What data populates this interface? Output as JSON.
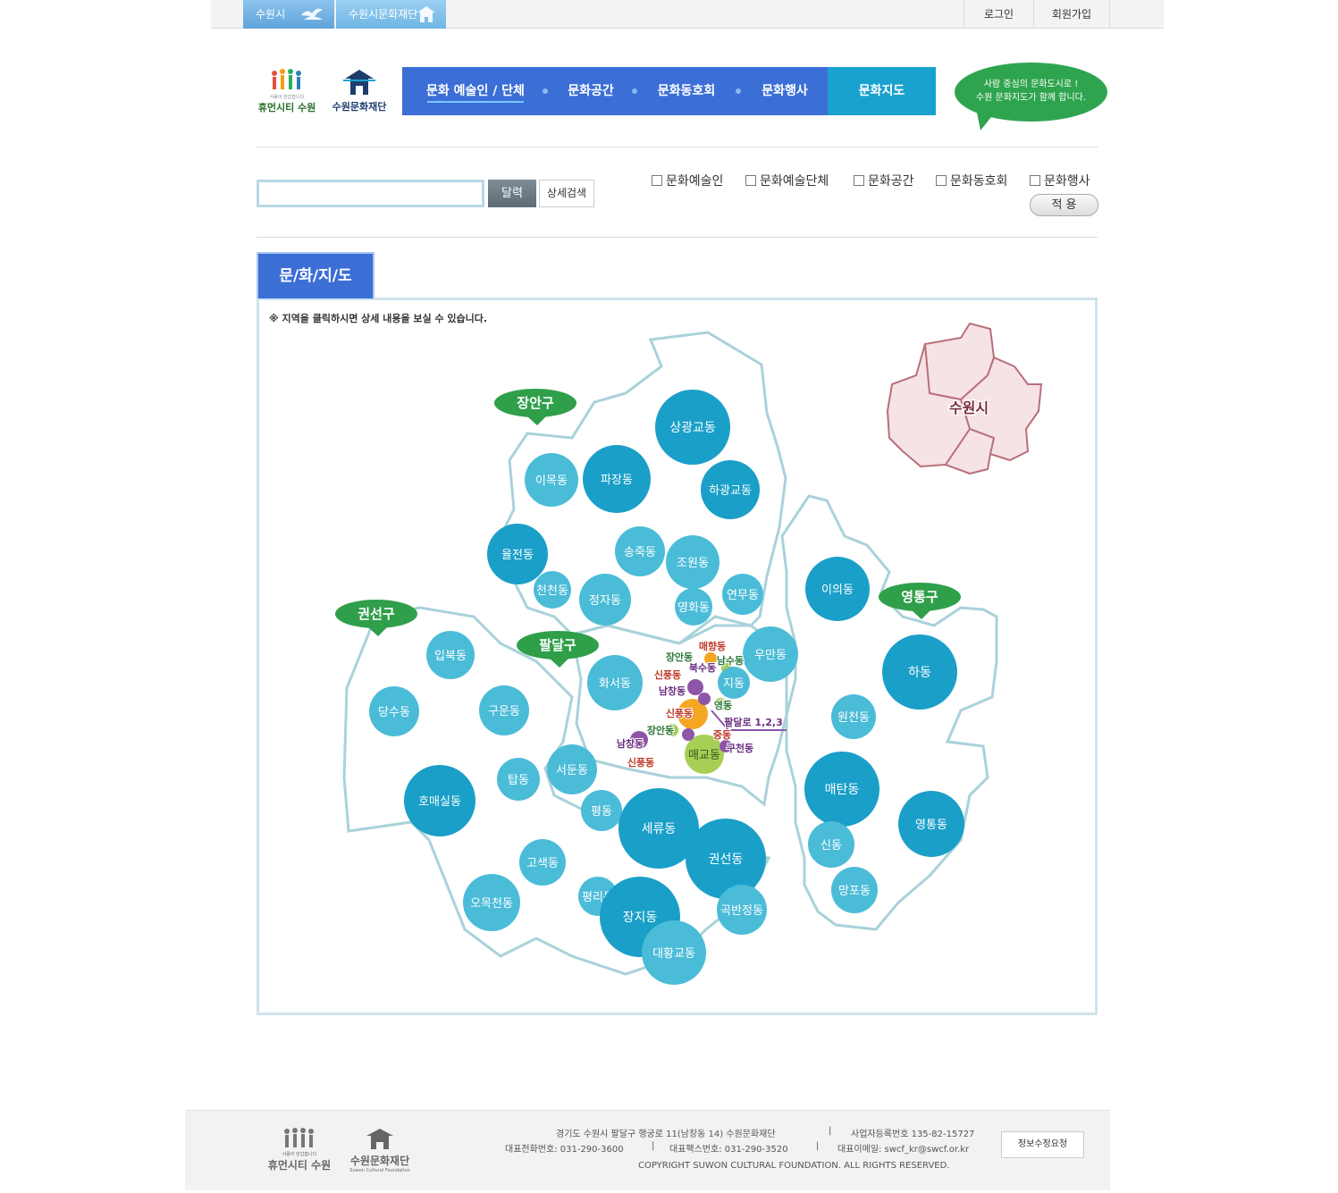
{
  "topbar": {
    "link_suwon": "수원시",
    "link_foundation": "수원시문화재단",
    "login": "로그인",
    "join": "회원가입"
  },
  "header": {
    "logo_city_tagline": "사람이 반갑습니다",
    "logo_city": "휴먼시티 수원",
    "logo_foundation": "수원문화재단",
    "nav": [
      "문화 예술인 / 단체",
      "문화공간",
      "문화동호회",
      "문화행사",
      "문화지도"
    ],
    "bubble_line1": "사람 중심의 문화도시로 !",
    "bubble_line2": "수원 문화지도가 함께 합니다."
  },
  "search": {
    "button": "달력",
    "detail_button": "상세검색",
    "filters": [
      "문화예술인",
      "문화예술단체",
      "문화공간",
      "문화동호회",
      "문화행사"
    ],
    "apply": "적 용"
  },
  "map": {
    "tab": "문/화/지/도",
    "notice": "※ 지역을 클릭하시면 상세 내용을 보실 수 있습니다.",
    "inset_label": "수원시",
    "districts": [
      "장안구",
      "권선구",
      "팔달구",
      "영통구"
    ],
    "dongs": [
      "상광교동",
      "이목동",
      "파장동",
      "하광교동",
      "율전동",
      "송죽동",
      "조원동",
      "천천동",
      "정자동",
      "연무동",
      "영화동",
      "이의동",
      "입북동",
      "당수동",
      "구운동",
      "화서동",
      "우만동",
      "지동",
      "하동",
      "원천동",
      "탑동",
      "서둔동",
      "호매실동",
      "평동",
      "세류동",
      "권선동",
      "매탄동",
      "신동",
      "영통동",
      "고색동",
      "오목천동",
      "평리동",
      "장지동",
      "곡반정동",
      "망포동",
      "대황교동",
      "매교동"
    ],
    "small_dongs": [
      "매향동",
      "장안동",
      "남수동",
      "북수동",
      "신풍동",
      "남창동",
      "영동",
      "신풍동",
      "팔달로 1,2,3",
      "장안동",
      "중동",
      "남창동",
      "구천동",
      "신풍동"
    ]
  },
  "footer": {
    "logo_city_tagline": "사람이 반갑습니다",
    "logo_city": "휴먼시티 수원",
    "logo_foundation": "수원문화재단",
    "logo_foundation_en": "Suwon Cultural Foundation",
    "address": "경기도 수원시 팔달구 행궁로 11(남창동 14) 수원문화재단",
    "biz_no": "사업자등록번호 135-82-15727",
    "tel": "대표전화번호: 031-290-3600",
    "fax": "대표팩스번호: 031-290-3520",
    "email": "대표이메일: swcf_kr@swcf.or.kr",
    "copyright": "COPYRIGHT SUWON CULTURAL FOUNDATION. ALL RIGHTS RESERVED.",
    "edit_request": "정보수정요청"
  }
}
